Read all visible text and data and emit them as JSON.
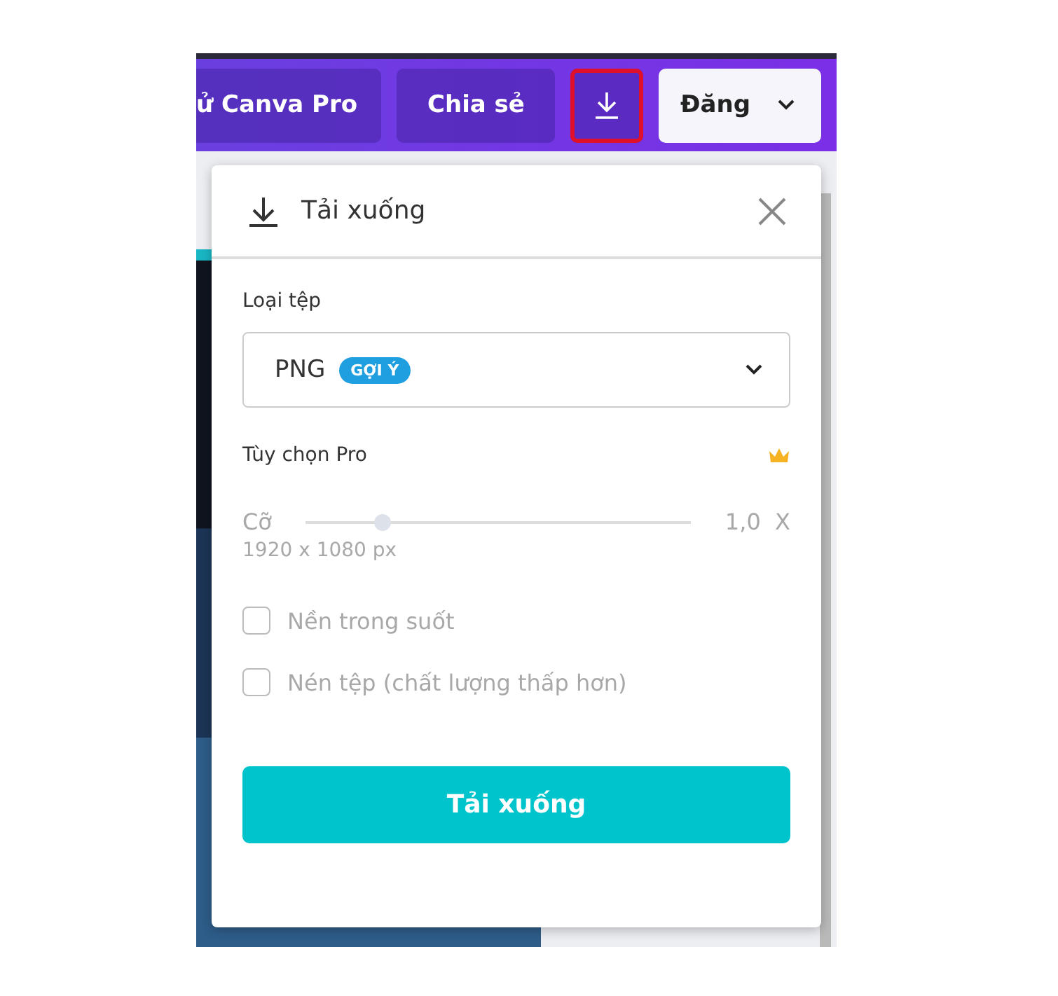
{
  "topbar": {
    "buttons": [
      {
        "kind": "text",
        "label": "ử Canva Pro",
        "highlighted": false
      },
      {
        "kind": "text",
        "label": "Chia sẻ",
        "highlighted": false
      },
      {
        "kind": "download",
        "highlighted": true
      },
      {
        "kind": "publish",
        "label": "Đăng",
        "highlighted": false
      }
    ]
  },
  "popup": {
    "title": "Tải xuống",
    "file_type": {
      "label": "Loại tệp",
      "value": "PNG",
      "badge": "GỢI Ý"
    },
    "pro_options": {
      "title": "Tùy chọn Pro",
      "disabled": true,
      "size": {
        "label": "Cỡ",
        "level": 0.2,
        "reading": "1,0  X"
      },
      "dimensions": "1920 x 1080 px",
      "checkboxes": [
        {
          "label": "Nền trong suốt",
          "checked": false
        },
        {
          "label": "Nén tệp (chất lượng thấp hơn)",
          "checked": false
        }
      ]
    },
    "download_button": "Tải xuống"
  }
}
